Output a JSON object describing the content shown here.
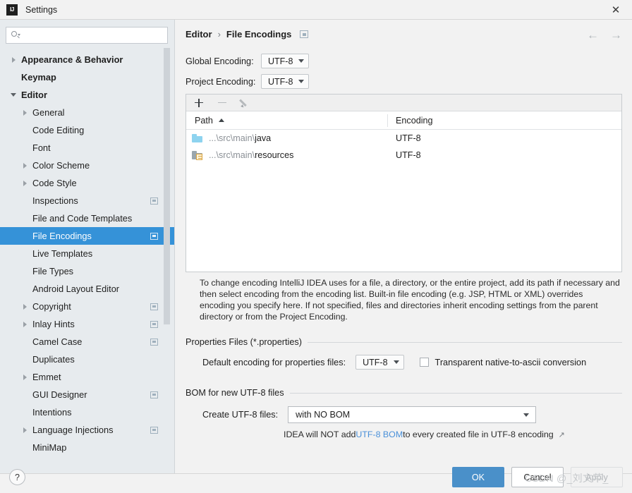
{
  "window": {
    "title": "Settings",
    "logo_icon": "intellij-idea-logo",
    "close_icon": "close-icon"
  },
  "search": {
    "placeholder": "",
    "value": "",
    "icon": "search-icon"
  },
  "sidebar": {
    "items": [
      {
        "label": "Appearance & Behavior",
        "arrow": "right",
        "indent": 0,
        "bold": true,
        "badge": false,
        "selected": false
      },
      {
        "label": "Keymap",
        "arrow": "none",
        "indent": 0,
        "bold": true,
        "badge": false,
        "selected": false
      },
      {
        "label": "Editor",
        "arrow": "down",
        "indent": 0,
        "bold": true,
        "badge": false,
        "selected": false
      },
      {
        "label": "General",
        "arrow": "right",
        "indent": 1,
        "bold": false,
        "badge": false,
        "selected": false
      },
      {
        "label": "Code Editing",
        "arrow": "none",
        "indent": 1,
        "bold": false,
        "badge": false,
        "selected": false
      },
      {
        "label": "Font",
        "arrow": "none",
        "indent": 1,
        "bold": false,
        "badge": false,
        "selected": false
      },
      {
        "label": "Color Scheme",
        "arrow": "right",
        "indent": 1,
        "bold": false,
        "badge": false,
        "selected": false
      },
      {
        "label": "Code Style",
        "arrow": "right",
        "indent": 1,
        "bold": false,
        "badge": false,
        "selected": false
      },
      {
        "label": "Inspections",
        "arrow": "none",
        "indent": 1,
        "bold": false,
        "badge": true,
        "selected": false
      },
      {
        "label": "File and Code Templates",
        "arrow": "none",
        "indent": 1,
        "bold": false,
        "badge": false,
        "selected": false
      },
      {
        "label": "File Encodings",
        "arrow": "none",
        "indent": 1,
        "bold": false,
        "badge": true,
        "selected": true
      },
      {
        "label": "Live Templates",
        "arrow": "none",
        "indent": 1,
        "bold": false,
        "badge": false,
        "selected": false
      },
      {
        "label": "File Types",
        "arrow": "none",
        "indent": 1,
        "bold": false,
        "badge": false,
        "selected": false
      },
      {
        "label": "Android Layout Editor",
        "arrow": "none",
        "indent": 1,
        "bold": false,
        "badge": false,
        "selected": false
      },
      {
        "label": "Copyright",
        "arrow": "right",
        "indent": 1,
        "bold": false,
        "badge": true,
        "selected": false
      },
      {
        "label": "Inlay Hints",
        "arrow": "right",
        "indent": 1,
        "bold": false,
        "badge": true,
        "selected": false
      },
      {
        "label": "Camel Case",
        "arrow": "none",
        "indent": 1,
        "bold": false,
        "badge": true,
        "selected": false
      },
      {
        "label": "Duplicates",
        "arrow": "none",
        "indent": 1,
        "bold": false,
        "badge": false,
        "selected": false
      },
      {
        "label": "Emmet",
        "arrow": "right",
        "indent": 1,
        "bold": false,
        "badge": false,
        "selected": false
      },
      {
        "label": "GUI Designer",
        "arrow": "none",
        "indent": 1,
        "bold": false,
        "badge": true,
        "selected": false
      },
      {
        "label": "Intentions",
        "arrow": "none",
        "indent": 1,
        "bold": false,
        "badge": false,
        "selected": false
      },
      {
        "label": "Language Injections",
        "arrow": "right",
        "indent": 1,
        "bold": false,
        "badge": true,
        "selected": false
      },
      {
        "label": "MiniMap",
        "arrow": "none",
        "indent": 1,
        "bold": false,
        "badge": false,
        "selected": false
      }
    ]
  },
  "breadcrumb": {
    "root": "Editor",
    "separator": "›",
    "leaf": "File Encodings",
    "badge_icon": "settings-badge-icon"
  },
  "nav": {
    "back_icon": "←",
    "forward_icon": "→"
  },
  "encodings": {
    "global_label": "Global Encoding:",
    "global_value": "UTF-8",
    "project_label": "Project Encoding:",
    "project_value": "UTF-8"
  },
  "table": {
    "toolbar": {
      "add_icon": "plus-icon",
      "remove_icon": "minus-icon",
      "edit_icon": "pencil-icon"
    },
    "columns": [
      "Path",
      "Encoding"
    ],
    "sort_column": "Path",
    "sort_direction": "ascending",
    "rows": [
      {
        "path": "...\\src\\main\\java",
        "path_prefix": "...\\src\\main\\",
        "path_name": "java",
        "encoding": "UTF-8",
        "icon": "folder-icon"
      },
      {
        "path": "...\\src\\main\\resources",
        "path_prefix": "...\\src\\main\\",
        "path_name": "resources",
        "encoding": "UTF-8",
        "icon": "resources-folder-icon"
      }
    ]
  },
  "help_text": "To change encoding IntelliJ IDEA uses for a file, a directory, or the entire project, add its path if necessary and then select encoding from the encoding list. Built-in file encoding (e.g. JSP, HTML or XML) overrides encoding you specify here. If not specified, files and directories inherit encoding settings from the parent directory or from the Project Encoding.",
  "properties_section": {
    "title": "Properties Files (*.properties)",
    "default_encoding_label": "Default encoding for properties files:",
    "default_encoding_value": "UTF-8",
    "transparent_checkbox_label": "Transparent native-to-ascii conversion",
    "transparent_checked": false
  },
  "bom_section": {
    "title": "BOM for new UTF-8 files",
    "create_label": "Create UTF-8 files:",
    "create_value": "with NO BOM",
    "note_prefix": "IDEA will NOT add ",
    "note_link": "UTF-8 BOM",
    "note_suffix": " to every created file in UTF-8 encoding",
    "external_link_icon": "↗"
  },
  "footer": {
    "help_label": "?",
    "ok_label": "OK",
    "cancel_label": "Cancel",
    "apply_label": "Apply"
  },
  "watermark": "CSDN @_刘文芊_",
  "colors": {
    "accent_blue": "#3592d8",
    "ok_button": "#4a90c9",
    "link_blue": "#4a90d9",
    "sidebar_bg": "#e7ebee",
    "panel_bg": "#f2f2f2",
    "folder_blue": "#8ed3ef"
  }
}
